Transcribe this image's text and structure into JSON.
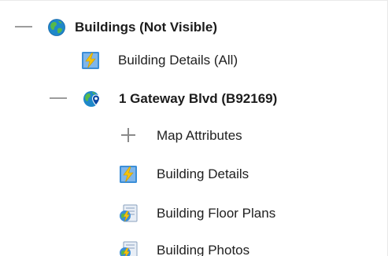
{
  "tree": {
    "root": {
      "label": "Buildings (Not Visible)",
      "icon": "globe-icon",
      "expanded": true
    },
    "root_child": {
      "label": "Building Details (All)",
      "icon": "building-details-icon"
    },
    "building": {
      "label": "1 Gateway Blvd (B92169)",
      "icon": "globe-location-pin-icon",
      "expanded": true
    },
    "building_children": [
      {
        "label": "Map Attributes",
        "icon": "expand-plus-icon",
        "expanded": false
      },
      {
        "label": "Building Details",
        "icon": "building-details-icon"
      },
      {
        "label": "Building Floor Plans",
        "icon": "floor-plans-icon"
      },
      {
        "label": "Building Photos",
        "icon": "photos-icon"
      }
    ]
  },
  "colors": {
    "globe_blue": "#1e88c9",
    "globe_green": "#4caf50",
    "pin_blue": "#0d47a1",
    "report_yellow": "#f4c20d",
    "report_blue": "#3b8ed8"
  }
}
